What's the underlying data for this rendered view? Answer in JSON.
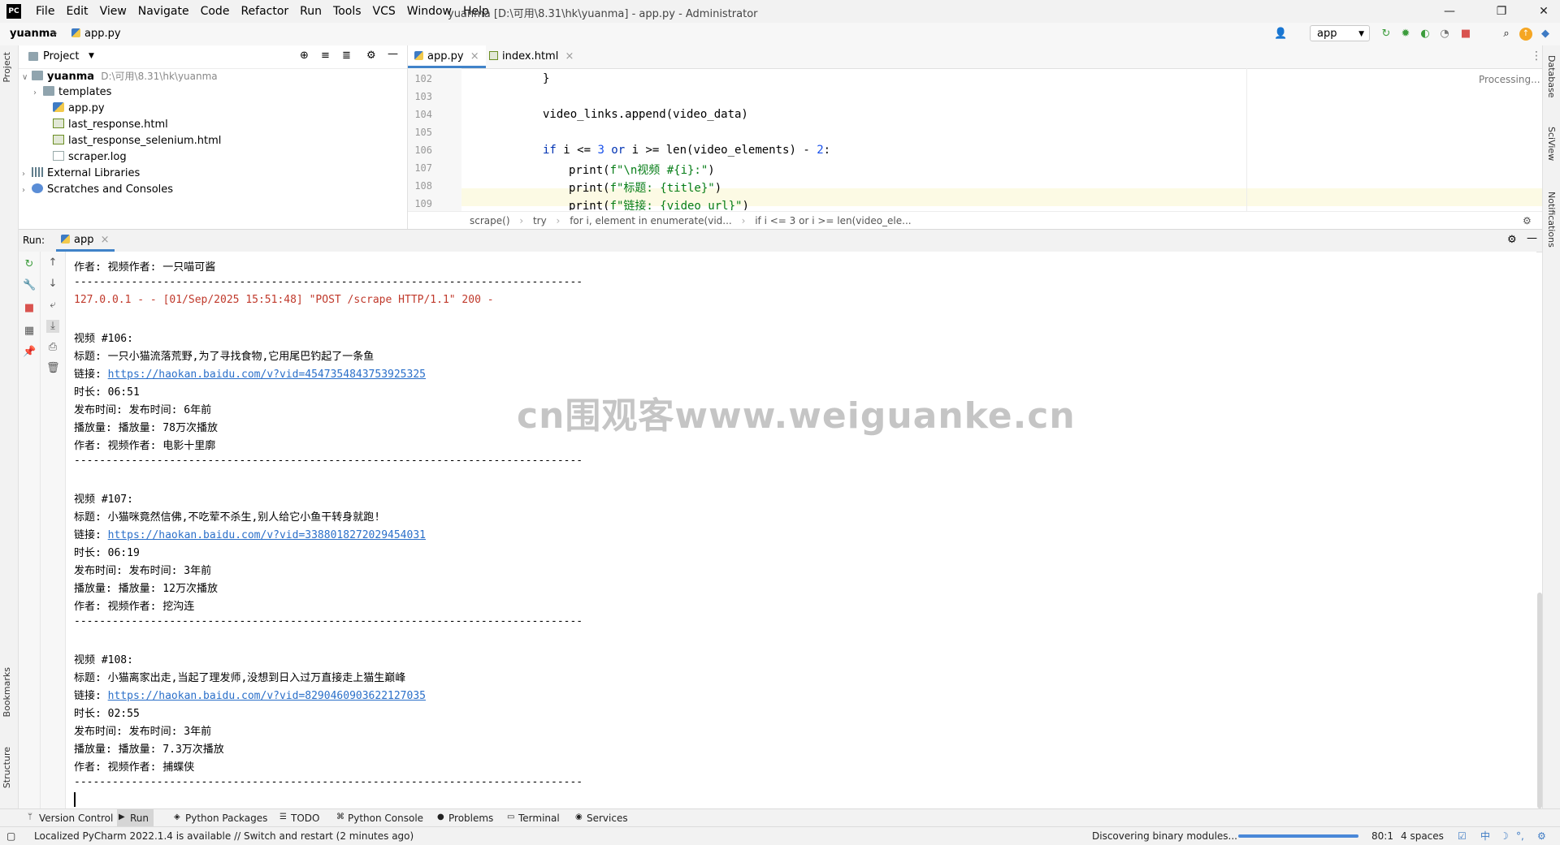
{
  "titlebar": {
    "logo": "PC",
    "menu": [
      "File",
      "Edit",
      "View",
      "Navigate",
      "Code",
      "Refactor",
      "Run",
      "Tools",
      "VCS",
      "Window",
      "Help"
    ],
    "title": "yuanma [D:\\可用\\8.31\\hk\\yuanma] - app.py - Administrator",
    "minimize": "—",
    "maximize": "❐",
    "close": "✕"
  },
  "navbar": {
    "project": "yuanma",
    "file": "app.py",
    "run_config": "app"
  },
  "left_strip": {
    "project": "Project",
    "bookmarks": "Bookmarks",
    "structure": "Structure"
  },
  "right_strip": {
    "database": "Database",
    "sciview": "SciView",
    "notifications": "Notifications"
  },
  "project_panel": {
    "title": "Project",
    "root_name": "yuanma",
    "root_path": "D:\\可用\\8.31\\hk\\yuanma",
    "items": [
      {
        "name": "templates"
      },
      {
        "name": "app.py"
      },
      {
        "name": "last_response.html"
      },
      {
        "name": "last_response_selenium.html"
      },
      {
        "name": "scraper.log"
      },
      {
        "name": "External Libraries"
      },
      {
        "name": "Scratches and Consoles"
      }
    ]
  },
  "editor": {
    "tabs": [
      {
        "label": "app.py"
      },
      {
        "label": "index.html"
      }
    ],
    "status": "Processing...",
    "line_numbers": [
      "102",
      "103",
      "104",
      "105",
      "106",
      "107",
      "108",
      "109"
    ],
    "lines": {
      "l102": "}",
      "l104": "video_links.append(video_data)",
      "l106_kw1": "if",
      "l106_a": " i <= ",
      "l106_n1": "3",
      "l106_kw2": " or",
      "l106_b": " i >= len(video_elements) - ",
      "l106_n2": "2",
      "l106_c": ":",
      "l107_fn": "print(",
      "l107_str": "f\"\\n视频 #{i}:\"",
      "l107_end": ")",
      "l108_fn": "print(",
      "l108_str": "f\"标题: {title}\"",
      "l108_end": ")",
      "l109_fn": "print(",
      "l109_str": "f\"链接: {video_url}\"",
      "l109_end": ")"
    },
    "breadcrumb": [
      "scrape()",
      "try",
      "for i, element in enumerate(vid...",
      "if i <= 3 or i >= len(video_ele..."
    ]
  },
  "run_panel": {
    "label": "Run:",
    "tab": "app",
    "console": {
      "top_author": "作者: 视频作者: 一只喵可酱",
      "separator": "--------------------------------------------------------------------------------",
      "log": "127.0.0.1 - - [01/Sep/2025 15:51:48] \"POST /scrape HTTP/1.1\" 200 -",
      "videos": [
        {
          "header": "视频 #106:",
          "title": "标题: 一只小猫流落荒野,为了寻找食物,它用尾巴钓起了一条鱼",
          "link_label": "链接: ",
          "link": "https://haokan.baidu.com/v?vid=4547354843753925325",
          "duration": "时长: 06:51",
          "published": "发布时间: 发布时间: 6年前",
          "plays": "播放量: 播放量: 78万次播放",
          "author": "作者: 视频作者: 电影十里廓"
        },
        {
          "header": "视频 #107:",
          "title": "标题: 小猫咪竟然信佛,不吃荤不杀生,别人给它小鱼干转身就跑!",
          "link_label": "链接: ",
          "link": "https://haokan.baidu.com/v?vid=3388018272029454031",
          "duration": "时长: 06:19",
          "published": "发布时间: 发布时间: 3年前",
          "plays": "播放量: 播放量: 12万次播放",
          "author": "作者: 视频作者: 挖沟连"
        },
        {
          "header": "视频 #108:",
          "title": "标题: 小猫离家出走,当起了理发师,没想到日入过万直接走上猫生巅峰",
          "link_label": "链接: ",
          "link": "https://haokan.baidu.com/v?vid=8290460903622127035",
          "duration": "时长: 02:55",
          "published": "发布时间: 发布时间: 3年前",
          "plays": "播放量: 播放量: 7.3万次播放",
          "author": "作者: 视频作者: 捕蝶侠"
        }
      ]
    }
  },
  "watermark": "cn围观客www.weiguanke.cn",
  "bottom_tabs": [
    "Version Control",
    "Run",
    "Python Packages",
    "TODO",
    "Python Console",
    "Problems",
    "Terminal",
    "Services"
  ],
  "status_bar": {
    "message": "Localized PyCharm 2022.1.4 is available // Switch and restart (2 minutes ago)",
    "task": "Discovering binary modules...",
    "position": "80:1",
    "indent": "4 spaces",
    "ime": "中"
  },
  "colors": {
    "accent": "#4083c9",
    "log_red": "#c0392b",
    "link": "#2a6fc9"
  }
}
